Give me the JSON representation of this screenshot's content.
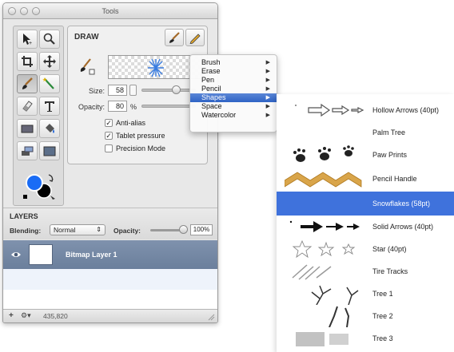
{
  "window": {
    "title": "Tools"
  },
  "draw_panel": {
    "title": "DRAW",
    "size_label": "Size:",
    "size_value": "58",
    "opacity_label": "Opacity:",
    "opacity_value": "80",
    "opacity_unit": "%",
    "anti_alias": {
      "label": "Anti-alias",
      "checked": true
    },
    "tablet_pressure": {
      "label": "Tablet pressure",
      "checked": true
    },
    "precision_mode": {
      "label": "Precision Mode",
      "checked": false
    }
  },
  "layers": {
    "title": "LAYERS",
    "blending_label": "Blending:",
    "blending_value": "Normal",
    "opacity_label": "Opacity:",
    "opacity_value": "100%",
    "rows": [
      {
        "name": "Bitmap Layer 1",
        "visible": true
      }
    ]
  },
  "status": {
    "add": "+",
    "gear": "⚙▾",
    "coords": "435,820"
  },
  "menu": {
    "items": [
      {
        "label": "Brush",
        "has_submenu": true
      },
      {
        "label": "Erase",
        "has_submenu": true
      },
      {
        "label": "Pen",
        "has_submenu": true
      },
      {
        "label": "Pencil",
        "has_submenu": true
      },
      {
        "label": "Shapes",
        "has_submenu": true,
        "selected": true
      },
      {
        "label": "Space",
        "has_submenu": true
      },
      {
        "label": "Watercolor",
        "has_submenu": true
      }
    ]
  },
  "submenu": {
    "items": [
      {
        "label": "Hollow Arrows (40pt)",
        "icon": "hollow-arrows-icon"
      },
      {
        "label": "Palm Tree",
        "icon": "palm-tree-icon"
      },
      {
        "label": "Paw Prints",
        "icon": "paw-prints-icon"
      },
      {
        "label": "Pencil Handle",
        "icon": "pencil-handle-icon"
      },
      {
        "label": "Snowflakes (58pt)",
        "icon": "snowflakes-icon",
        "selected": true
      },
      {
        "label": "Solid Arrows (40pt)",
        "icon": "solid-arrows-icon"
      },
      {
        "label": "Star (40pt)",
        "icon": "star-icon"
      },
      {
        "label": "Tire Tracks",
        "icon": "tire-tracks-icon"
      },
      {
        "label": "Tree 1",
        "icon": "tree-icon"
      },
      {
        "label": "Tree 2",
        "icon": "tree-icon"
      },
      {
        "label": "Tree 3",
        "icon": "tree-icon"
      }
    ]
  },
  "colors": {
    "foreground": "#1a6cf5",
    "background": "#000000",
    "selection": "#3f72dc",
    "layer_row": "#6f83a0"
  }
}
